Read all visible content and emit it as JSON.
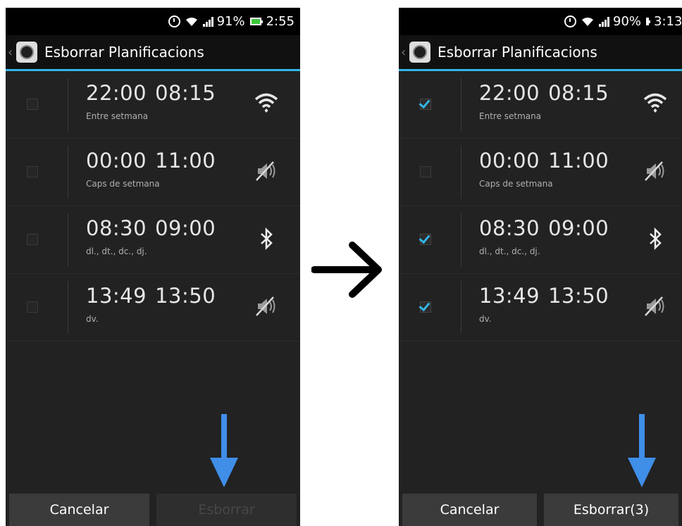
{
  "colors": {
    "accent": "#33b5e5",
    "arrow_blue": "#3f8ee8",
    "background": "#222222"
  },
  "app_title": "Esborrar Planificacions",
  "before": {
    "status": {
      "battery": "91%",
      "time": "2:55"
    },
    "rows": [
      {
        "start": "22:00",
        "end": "08:15",
        "days": "Entre setmana",
        "icon": "wifi-icon",
        "checked": false
      },
      {
        "start": "00:00",
        "end": "11:00",
        "days": "Caps de setmana",
        "icon": "mute-icon",
        "checked": false
      },
      {
        "start": "08:30",
        "end": "09:00",
        "days": "dl., dt., dc., dj.",
        "icon": "bluetooth-icon",
        "checked": false
      },
      {
        "start": "13:49",
        "end": "13:50",
        "days": "dv.",
        "icon": "mute-icon",
        "checked": false
      }
    ],
    "buttons": {
      "cancel": "Cancelar",
      "delete": "Esborrar"
    }
  },
  "after": {
    "status": {
      "battery": "90%",
      "time": "3:13"
    },
    "rows": [
      {
        "start": "22:00",
        "end": "08:15",
        "days": "Entre setmana",
        "icon": "wifi-icon",
        "checked": true
      },
      {
        "start": "00:00",
        "end": "11:00",
        "days": "Caps de setmana",
        "icon": "mute-icon",
        "checked": false
      },
      {
        "start": "08:30",
        "end": "09:00",
        "days": "dl., dt., dc., dj.",
        "icon": "bluetooth-icon",
        "checked": true
      },
      {
        "start": "13:49",
        "end": "13:50",
        "days": "dv.",
        "icon": "mute-icon",
        "checked": true
      }
    ],
    "buttons": {
      "cancel": "Cancelar",
      "delete": "Esborrar(3)"
    }
  }
}
